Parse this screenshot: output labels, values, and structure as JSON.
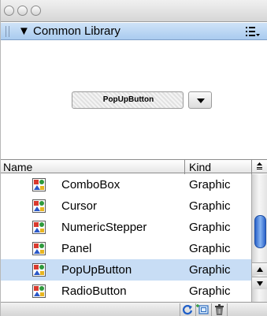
{
  "panel": {
    "title": "Common Library"
  },
  "preview": {
    "component_label": "PopUpButton"
  },
  "columns": {
    "name": "Name",
    "kind": "Kind"
  },
  "items": [
    {
      "name": "ComboBox",
      "kind": "Graphic"
    },
    {
      "name": "Cursor",
      "kind": "Graphic"
    },
    {
      "name": "NumericStepper",
      "kind": "Graphic"
    },
    {
      "name": "Panel",
      "kind": "Graphic"
    },
    {
      "name": "PopUpButton",
      "kind": "Graphic",
      "selected": true
    },
    {
      "name": "RadioButton",
      "kind": "Graphic"
    }
  ],
  "icons": {
    "disclosure": "disclosure-triangle-down-icon",
    "panel_menu": "panel-menu-icon",
    "item": "graphic-symbol-icon",
    "refresh": "refresh-icon",
    "new_symbol": "new-symbol-icon",
    "delete": "trash-icon"
  },
  "colors": {
    "panel_header": "#b7d3f2",
    "selected_row": "#c8ddf5",
    "scroll_thumb": "#2a62c9",
    "refresh_icon": "#1f5fc8"
  }
}
